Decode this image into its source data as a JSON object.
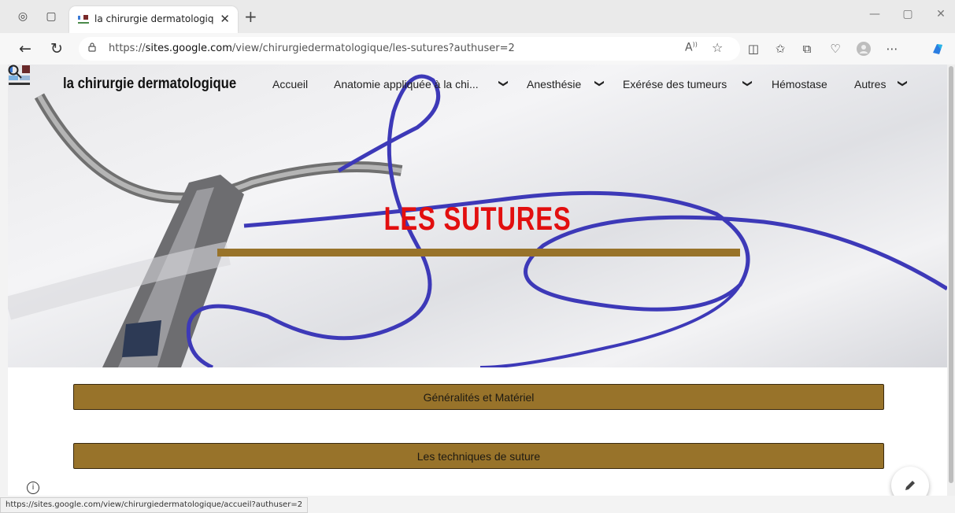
{
  "browser": {
    "tab_title": "la chirurgie dermatologique - Les",
    "url_prefix": "https://",
    "url_domain": "sites.google.com",
    "url_path": "/view/chirurgiedermatologique/les-sutures?authuser=2",
    "status_url": "https://sites.google.com/view/chirurgiedermatologique/accueil?authuser=2"
  },
  "site": {
    "title": "la chirurgie dermatologique",
    "nav": [
      {
        "label": "Accueil"
      },
      {
        "label": "Anatomie appliquée à la chi..."
      },
      {
        "label": "Anesthésie"
      },
      {
        "label": "Exérése des tumeurs"
      },
      {
        "label": "Hémostase"
      },
      {
        "label": "Autres"
      }
    ]
  },
  "hero": {
    "title": "LES SUTURES"
  },
  "sections": [
    {
      "label": "Généralités et Matériel"
    },
    {
      "label": "Les techniques de suture"
    }
  ],
  "colors": {
    "accent_gold": "#98732a",
    "hero_title_red": "#e20f0f",
    "thread_blue": "#4a46c8"
  }
}
